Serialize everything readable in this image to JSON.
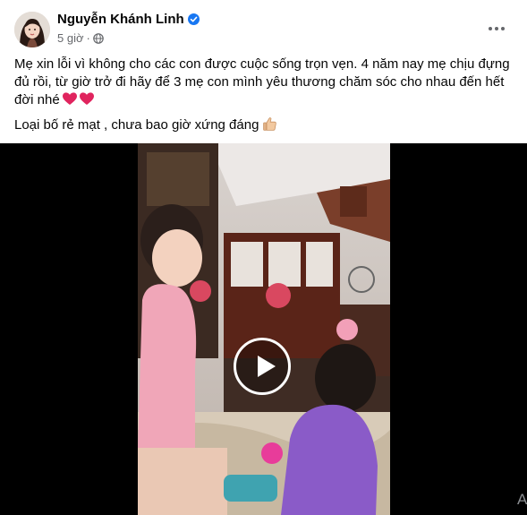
{
  "post": {
    "author": "Nguyễn Khánh Linh",
    "time": "5 giờ",
    "separator": "·",
    "icons": {
      "verified": "verified-badge-icon",
      "audience": "globe-icon",
      "more": "more-options-icon",
      "play": "play-icon"
    },
    "caption_line1": "Mẹ xin lỗi vì không cho các con được cuộc sống trọn vẹn. 4 năm nay mẹ chịu đựng đủ rồi, từ giờ trở đi hãy để 3 mẹ con mình yêu thương chăm sóc cho nhau đến hết đời nhé",
    "caption_line2": "Loại bố rẻ mạt , chưa bao giờ xứng đáng",
    "emoji": [
      "red-heart",
      "red-heart",
      "thumbs-up"
    ],
    "corner_glyph": "A"
  },
  "colors": {
    "brand_blue": "#1877f2",
    "secondary_text": "#65676b",
    "heart_red": "#e0245e",
    "video_bg": "#000000"
  }
}
